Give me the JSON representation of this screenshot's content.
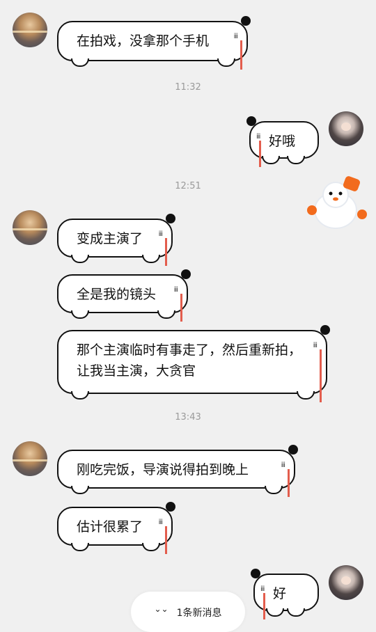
{
  "messages": [
    {
      "id": "m1",
      "side": "left",
      "text": "在拍戏，没拿那个手机"
    },
    {
      "id": "m2",
      "side": "right",
      "text": "好哦"
    },
    {
      "id": "m3",
      "side": "left",
      "text": "变成主演了"
    },
    {
      "id": "m4",
      "side": "left",
      "text": "全是我的镜头"
    },
    {
      "id": "m5",
      "side": "left",
      "text": "那个主演临时有事走了，然后重新拍，让我当主演，大贪官"
    },
    {
      "id": "m6",
      "side": "left",
      "text": "刚吃完饭，导演说得拍到晚上"
    },
    {
      "id": "m7",
      "side": "left",
      "text": "估计很累了"
    },
    {
      "id": "m8",
      "side": "right",
      "text": "好"
    }
  ],
  "timestamps": [
    "11:32",
    "12:51",
    "13:43"
  ],
  "sticker": {
    "icon": "snowman-sticker"
  },
  "new_message_pill": {
    "label": "1条新消息",
    "icon": "double-chevron-down-icon"
  },
  "colors": {
    "background": "#f0f0f0",
    "bubble_fill": "#ffffff",
    "bubble_border": "#111111",
    "tear_accent": "#e35d4d",
    "timestamp_text": "#9a9a9a"
  }
}
